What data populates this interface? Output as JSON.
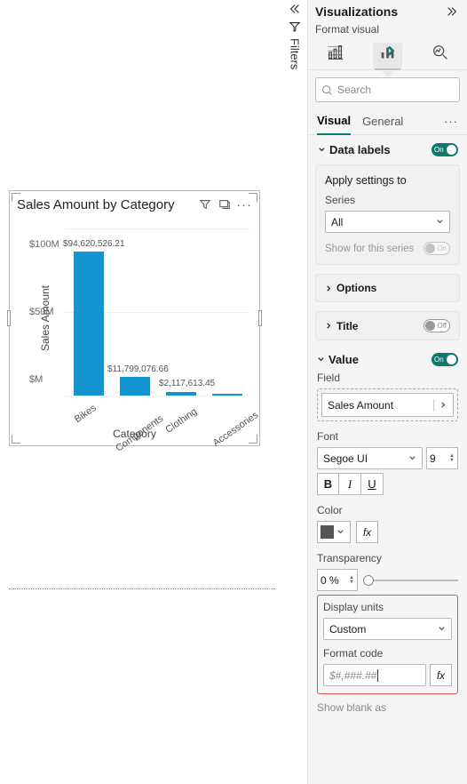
{
  "filters_label": "Filters",
  "panel": {
    "title": "Visualizations",
    "subtitle": "Format visual",
    "search_placeholder": "Search",
    "tabs": {
      "visual": "Visual",
      "general": "General"
    }
  },
  "data_labels": {
    "label": "Data labels",
    "on": "On"
  },
  "apply_settings": {
    "title": "Apply settings to",
    "series_label": "Series",
    "series_value": "All",
    "show_for_series": "Show for this series",
    "show_for_series_state": "On"
  },
  "options": {
    "label": "Options"
  },
  "title_row": {
    "label": "Title",
    "state": "Off"
  },
  "value": {
    "label": "Value",
    "on": "On",
    "field_label": "Field",
    "field_value": "Sales Amount",
    "font_label": "Font",
    "font_family": "Segoe UI",
    "font_size": "9",
    "bold": "B",
    "italic": "I",
    "underline": "U",
    "color_label": "Color",
    "fx": "fx",
    "transparency_label": "Transparency",
    "transparency_value": "0 %",
    "display_units_label": "Display units",
    "display_units_value": "Custom",
    "format_code_label": "Format code",
    "format_code_value": "$#,###.##",
    "show_blank_as": "Show blank as"
  },
  "chart_data": {
    "type": "bar",
    "title": "Sales Amount by Category",
    "xlabel": "Category",
    "ylabel": "Sales Amount",
    "categories": [
      "Bikes",
      "Components",
      "Clothing",
      "Accessories"
    ],
    "values": [
      94620526.21,
      11799076.66,
      2117613.45,
      700000
    ],
    "data_labels": [
      "$94,620,526.21",
      "$11,799,076.66",
      "$2,117,613.45",
      ""
    ],
    "y_ticks": [
      "$M",
      "$50M",
      "$100M"
    ],
    "ylim": [
      0,
      110000000
    ]
  }
}
